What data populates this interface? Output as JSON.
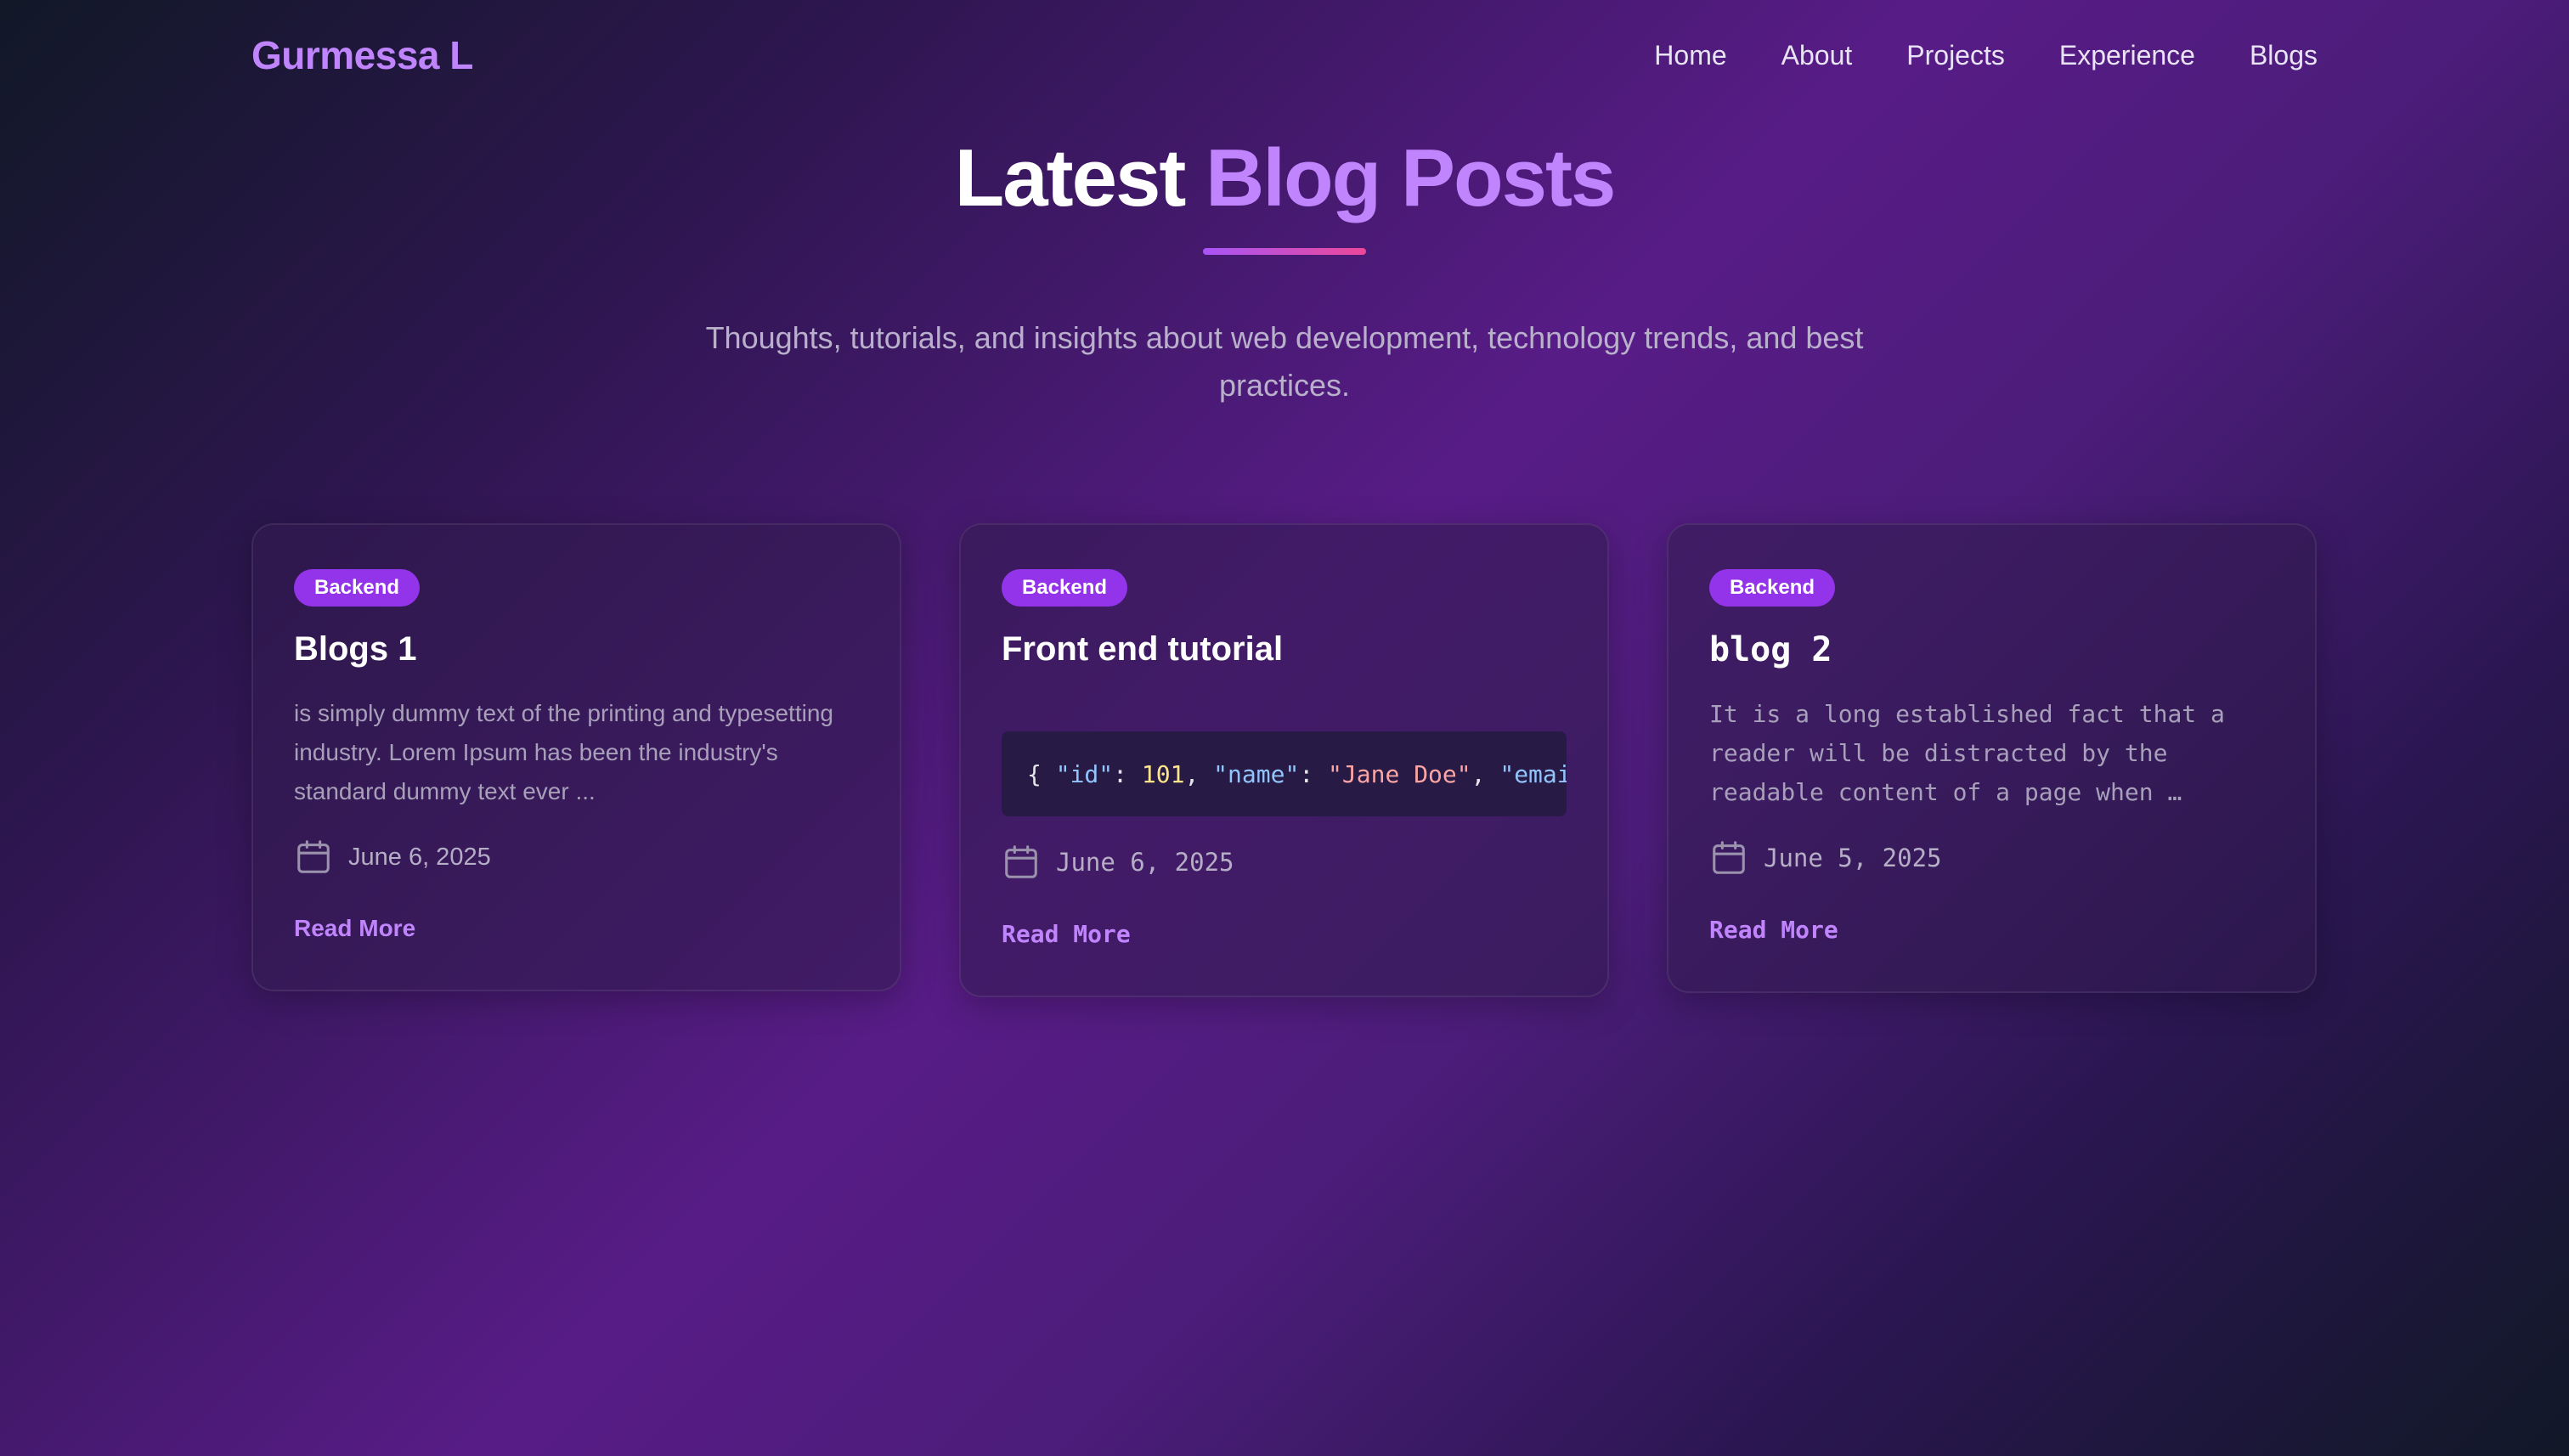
{
  "navbar": {
    "brand": "Gurmessa L",
    "links": [
      "Home",
      "About",
      "Projects",
      "Experience",
      "Blogs"
    ]
  },
  "hero": {
    "title_main": "Latest ",
    "title_accent": "Blog Posts",
    "subtitle": "Thoughts, tutorials, and insights about web development, technology trends, and best practices."
  },
  "posts": [
    {
      "category": "Backend",
      "title": "Blogs 1",
      "excerpt": "is simply dummy text of the printing and typesetting industry. Lorem Ipsum has been the industry's standard dummy text ever ...",
      "date": "June 6, 2025",
      "read_more": "Read More"
    },
    {
      "category": "Backend",
      "title": "Front end tutorial",
      "code": {
        "open": "{ ",
        "k1": "\"id\"",
        "c1": ": ",
        "v1": "101",
        "s1": ", ",
        "k2": "\"name\"",
        "c2": ": ",
        "v2": "\"Jane Doe\"",
        "s2": ", ",
        "k3": "\"emai"
      },
      "date": "June 6, 2025",
      "read_more": "Read More"
    },
    {
      "category": "Backend",
      "title": "blog 2",
      "excerpt": "It is a long established fact that a reader will be distracted by the readable content of a page when …",
      "date": "June 5, 2025",
      "read_more": "Read More"
    }
  ],
  "colors": {
    "accent": "#c084fc",
    "badge": "#9333ea",
    "underline_start": "#a855f7",
    "underline_end": "#ec4899"
  },
  "icons": {
    "date": "calendar-icon"
  }
}
